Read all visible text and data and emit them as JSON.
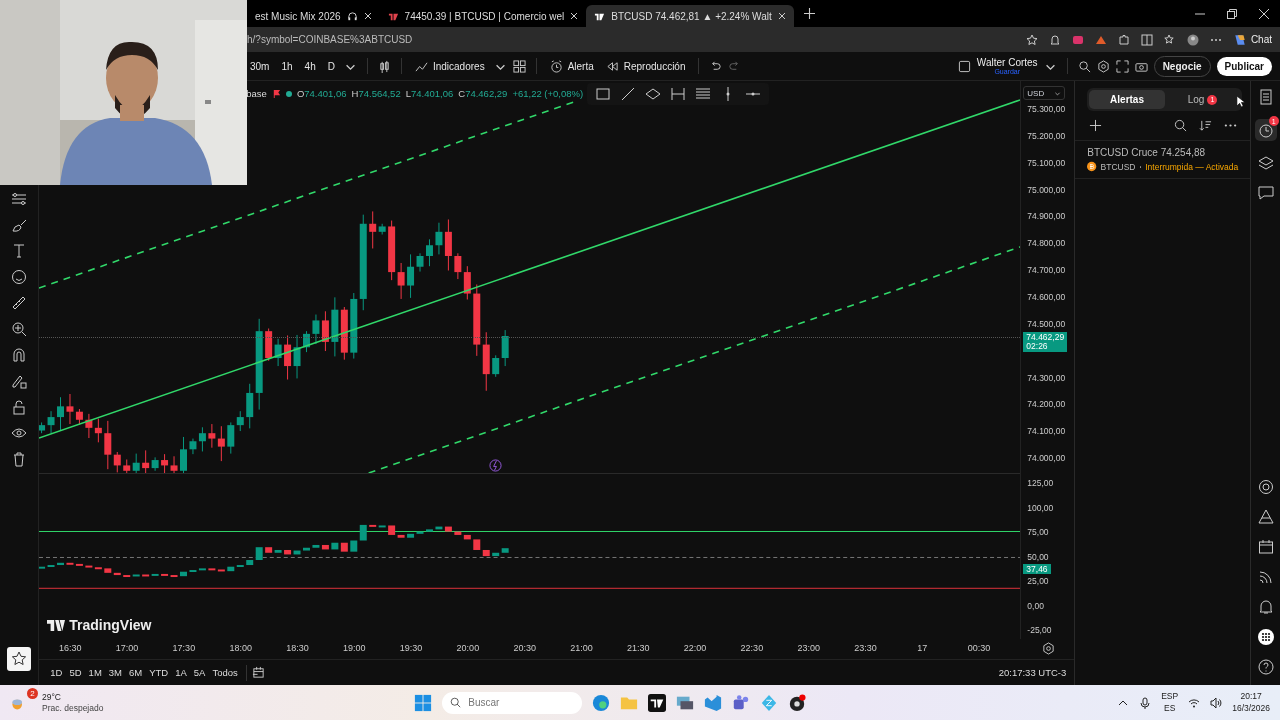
{
  "browser_tabs": [
    {
      "title": "est Music Mix 2026",
      "selected": false,
      "kind": "audio"
    },
    {
      "title": "74450.39 | BTCUSD | Comercio wel",
      "selected": false,
      "kind": "page"
    },
    {
      "title": "BTCUSD 74.462,81 ▲ +2.24% Walt",
      "selected": true,
      "kind": "page"
    }
  ],
  "address_bar": {
    "url": "h/?symbol=COINBASE%3ABTCUSD"
  },
  "browser_chat": "Chat",
  "toolbar": {
    "intervals": [
      "30m",
      "1h",
      "4h",
      "D"
    ],
    "indicators": "Indicadores",
    "alert": "Alerta",
    "replay": "Reproducción",
    "user_name": "Walter Cortes",
    "user_status": "Guardar",
    "trade": "Negocie",
    "publish": "Publicar"
  },
  "legend": {
    "symbol": "base",
    "values": [
      {
        "label": "O",
        "value": "74.401,06"
      },
      {
        "label": "H",
        "value": "74.564,52"
      },
      {
        "label": "L",
        "value": "74.401,06"
      },
      {
        "label": "C",
        "value": "74.462,29"
      }
    ],
    "change": "+61,22 (+0,08%)"
  },
  "currency": "USD",
  "price_axis_upper": [
    "75.300,00",
    "75.200,00",
    "75.100,00",
    "75.000,00",
    "74.900,00",
    "74.800,00",
    "74.700,00",
    "74.600,00",
    "74.500,00"
  ],
  "price_axis_lower": [
    "74.300,00",
    "74.200,00",
    "74.100,00",
    "74.000,00"
  ],
  "current_price": {
    "value": "74.462,29",
    "countdown": "02:26"
  },
  "oscillator_axis": [
    "125,00",
    "100,00",
    "75,00",
    "50,00",
    "25,00",
    "0,00",
    "-25,00"
  ],
  "oscillator_value": "37,46",
  "chart_logo": "TradingView",
  "time_axis": [
    "16:30",
    "17:00",
    "17:30",
    "18:00",
    "18:30",
    "19:00",
    "19:30",
    "20:00",
    "20:30",
    "21:00",
    "21:30",
    "22:00",
    "22:30",
    "23:00",
    "23:30",
    "17",
    "00:30"
  ],
  "ranges": [
    "1D",
    "5D",
    "1M",
    "3M",
    "6M",
    "YTD",
    "1A",
    "5A",
    "Todos"
  ],
  "clock": "20:17:33 UTC-3",
  "alerts_panel": {
    "tabs": [
      {
        "label": "Alertas",
        "selected": true
      },
      {
        "label": "Log",
        "selected": false,
        "badge": "1"
      }
    ],
    "alerts": [
      {
        "title": "BTCUSD Cruce 74.254,88",
        "symbol": "BTCUSD",
        "status": "Interrumpida — Activada"
      }
    ]
  },
  "side_badge": "1",
  "taskbar": {
    "weather_badge": "2",
    "temperature": "29°C",
    "weather": "Prac. despejado",
    "search_placeholder": "Buscar",
    "language": "ESP",
    "layout": "ES",
    "time": "20:17",
    "date": "16/3/2026"
  }
}
